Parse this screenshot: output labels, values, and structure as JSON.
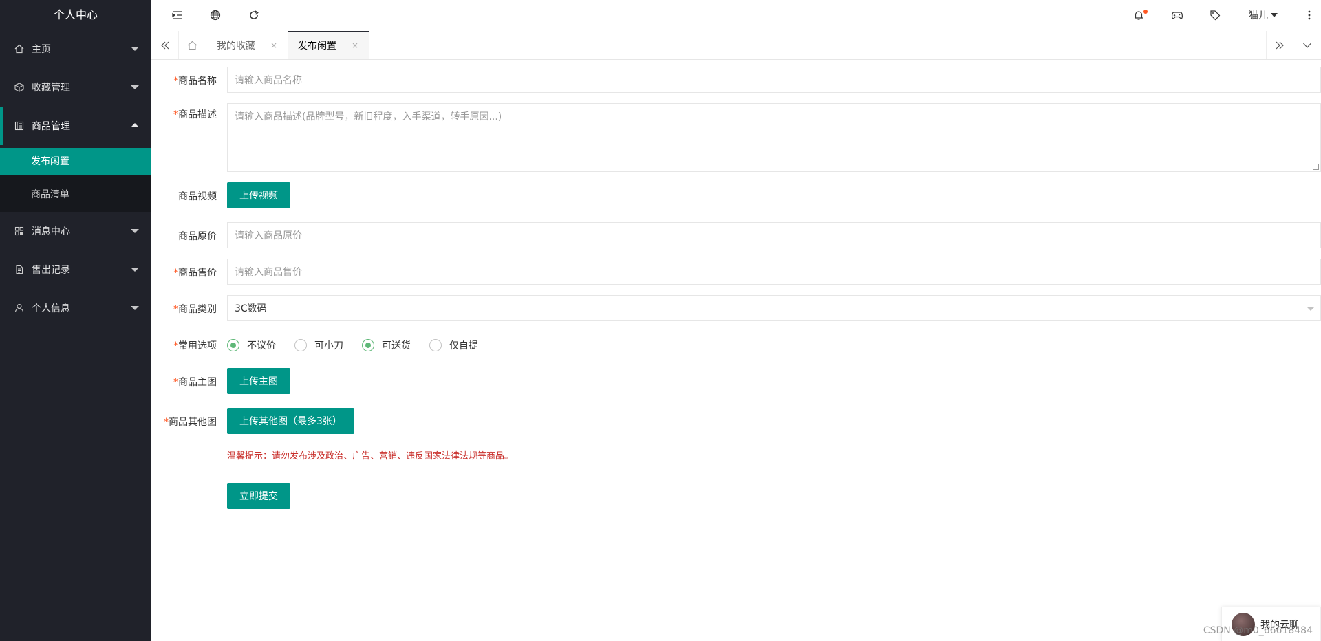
{
  "sidebar": {
    "title": "个人中心",
    "items": [
      {
        "label": "主页"
      },
      {
        "label": "收藏管理"
      },
      {
        "label": "商品管理"
      },
      {
        "label": "消息中心"
      },
      {
        "label": "售出记录"
      },
      {
        "label": "个人信息"
      }
    ],
    "sub_items": [
      {
        "label": "发布闲置"
      },
      {
        "label": "商品清单"
      }
    ]
  },
  "header": {
    "user_name": "猫儿"
  },
  "tabs": [
    {
      "label": "我的收藏",
      "close": "×"
    },
    {
      "label": "发布闲置",
      "close": "×"
    }
  ],
  "form": {
    "required_mark": "*",
    "name": {
      "label": "商品名称",
      "placeholder": "请输入商品名称"
    },
    "desc": {
      "label": "商品描述",
      "placeholder": "请输入商品描述(品牌型号，新旧程度，入手渠道，转手原因...)"
    },
    "video": {
      "label": "商品视频",
      "button": "上传视频"
    },
    "orig_price": {
      "label": "商品原价",
      "placeholder": "请输入商品原价"
    },
    "sale_price": {
      "label": "商品售价",
      "placeholder": "请输入商品售价"
    },
    "category": {
      "label": "商品类别",
      "value": "3C数码"
    },
    "options": {
      "label": "常用选项",
      "items": [
        {
          "label": "不议价",
          "checked": true
        },
        {
          "label": "可小刀",
          "checked": false
        },
        {
          "label": "可送货",
          "checked": true
        },
        {
          "label": "仅自提",
          "checked": false
        }
      ]
    },
    "main_image": {
      "label": "商品主图",
      "button": "上传主图"
    },
    "other_images": {
      "label": "商品其他图",
      "button": "上传其他图（最多3张）"
    },
    "tip": "温馨提示：请勿发布涉及政治、广告、营销、违反国家法律法规等商品。",
    "submit": "立即提交"
  },
  "chat": {
    "label": "我的云聊"
  },
  "watermark": "CSDN @m0_66618484",
  "colors": {
    "accent": "#009688",
    "sidebar_bg": "#20222a",
    "radio_checked": "#5fb878",
    "tip": "#c9302c"
  }
}
